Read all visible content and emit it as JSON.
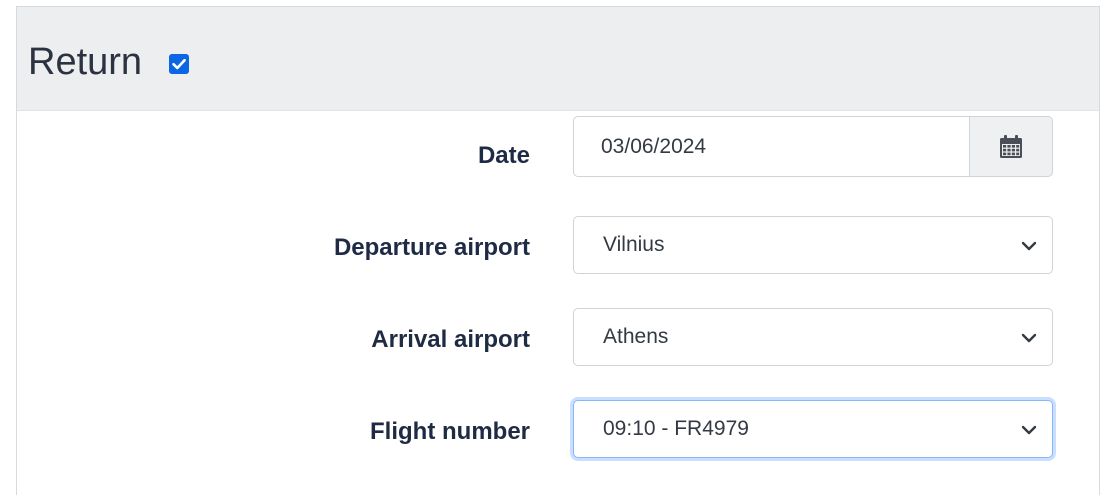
{
  "section": {
    "title": "Return",
    "return_checked": true
  },
  "form": {
    "date": {
      "label": "Date",
      "value": "03/06/2024"
    },
    "departure": {
      "label": "Departure airport",
      "value": "Vilnius"
    },
    "arrival": {
      "label": "Arrival airport",
      "value": "Athens"
    },
    "flight": {
      "label": "Flight number",
      "value": "09:10 - FR4979"
    }
  },
  "colors": {
    "accent": "#0a66e4",
    "header_bg": "#eceef0",
    "label_text": "#1f2b45",
    "focus_border": "#86b7fe"
  },
  "icons": {
    "checkbox": "checkbox-checked-icon",
    "calendar": "calendar-icon",
    "dropdown": "chevron-down-icon"
  }
}
